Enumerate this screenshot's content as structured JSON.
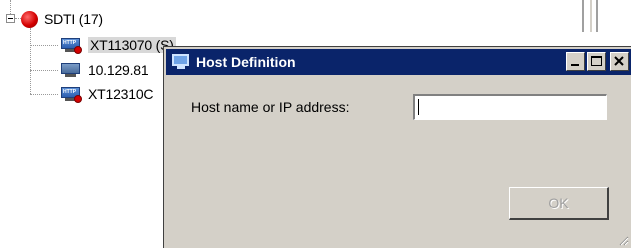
{
  "tree": {
    "group": {
      "label": "SDTI (17)",
      "icon": "red-circle-icon"
    },
    "hosts": [
      {
        "label": "XT113070 (S)",
        "icon": "host-monitor-icon",
        "status": "red"
      },
      {
        "label": "10.129.81",
        "icon": "monitor-icon"
      },
      {
        "label": "XT12310C",
        "icon": "host-monitor-icon",
        "status": "red"
      }
    ]
  },
  "dialog": {
    "title": "Host Definition",
    "field_label": "Host name or IP address:",
    "host_input_value": "",
    "ok_label": "OK"
  },
  "colors": {
    "titlebar": "#0a246a",
    "dialog_bg": "#d4d0c8",
    "status_red": "#d40000"
  }
}
